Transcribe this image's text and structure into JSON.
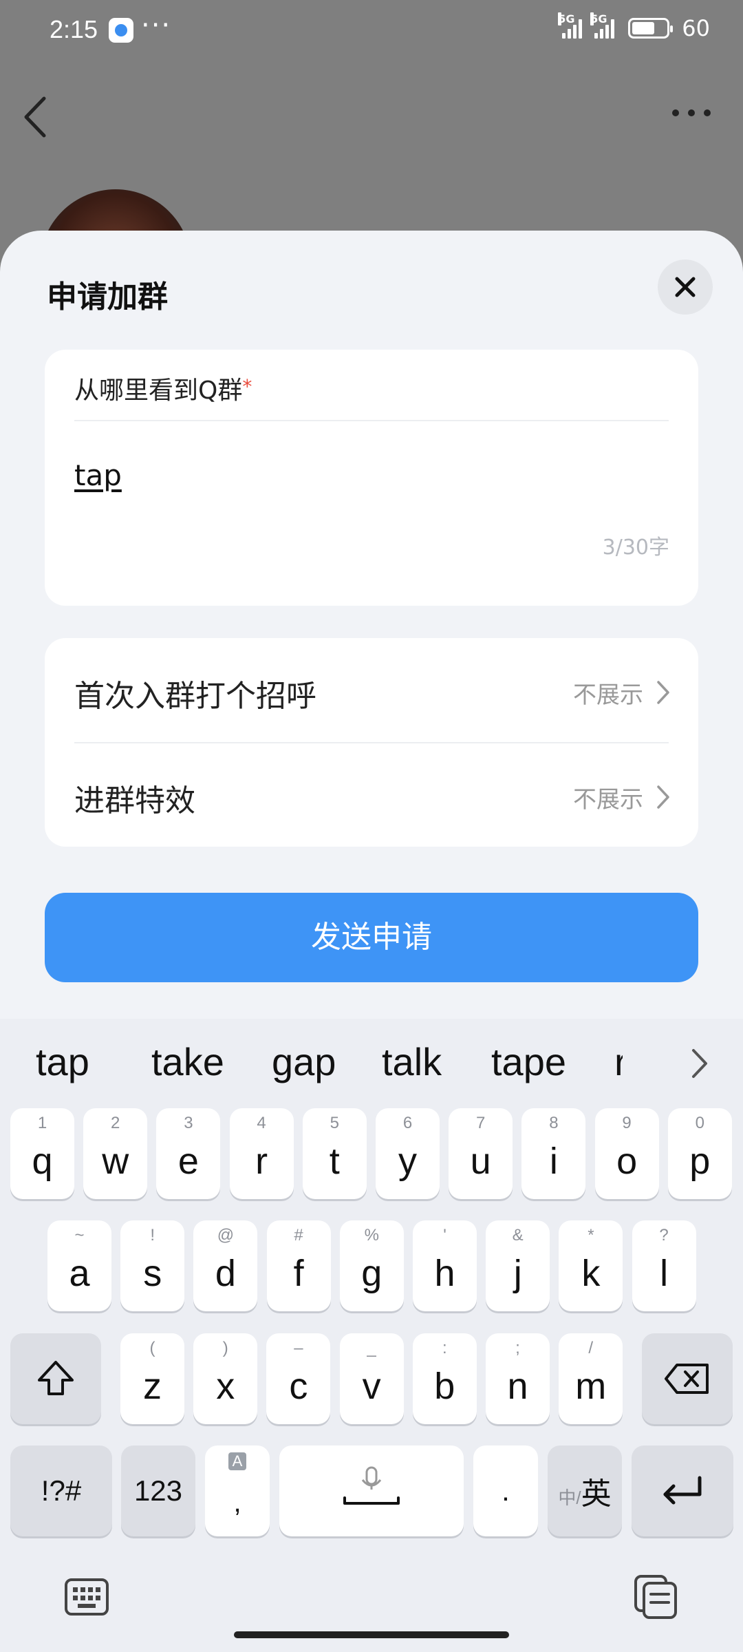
{
  "status_bar": {
    "time": "2:15",
    "dots": "···",
    "network1": "5G",
    "network2": "5G",
    "battery": "60"
  },
  "sheet": {
    "title": "申请加群",
    "question_label": "从哪里看到Q群",
    "required_mark": "*",
    "answer_value": "tap",
    "counter": "3/30字",
    "greeting_label": "首次入群打个招呼",
    "greeting_value": "不展示",
    "effect_label": "进群特效",
    "effect_value": "不展示",
    "send_label": "发送申请"
  },
  "keyboard": {
    "suggestions": [
      "tap",
      "take",
      "gap",
      "talk",
      "tape",
      "r"
    ],
    "row1": [
      {
        "k": "q",
        "s": "1"
      },
      {
        "k": "w",
        "s": "2"
      },
      {
        "k": "e",
        "s": "3"
      },
      {
        "k": "r",
        "s": "4"
      },
      {
        "k": "t",
        "s": "5"
      },
      {
        "k": "y",
        "s": "6"
      },
      {
        "k": "u",
        "s": "7"
      },
      {
        "k": "i",
        "s": "8"
      },
      {
        "k": "o",
        "s": "9"
      },
      {
        "k": "p",
        "s": "0"
      }
    ],
    "row2": [
      {
        "k": "a",
        "s": "~"
      },
      {
        "k": "s",
        "s": "!"
      },
      {
        "k": "d",
        "s": "@"
      },
      {
        "k": "f",
        "s": "#"
      },
      {
        "k": "g",
        "s": "%"
      },
      {
        "k": "h",
        "s": "'"
      },
      {
        "k": "j",
        "s": "&"
      },
      {
        "k": "k",
        "s": "*"
      },
      {
        "k": "l",
        "s": "?"
      }
    ],
    "row3": [
      {
        "k": "z",
        "s": "("
      },
      {
        "k": "x",
        "s": ")"
      },
      {
        "k": "c",
        "s": "–"
      },
      {
        "k": "v",
        "s": "_"
      },
      {
        "k": "b",
        "s": ":"
      },
      {
        "k": "n",
        "s": ";"
      },
      {
        "k": "m",
        "s": "/"
      }
    ],
    "symbols_key": "!?#",
    "num_key": "123",
    "comma_key": ",",
    "comma_sub": "A",
    "period_key": ".",
    "lang_key_small": "中/",
    "lang_key_big": "英"
  }
}
